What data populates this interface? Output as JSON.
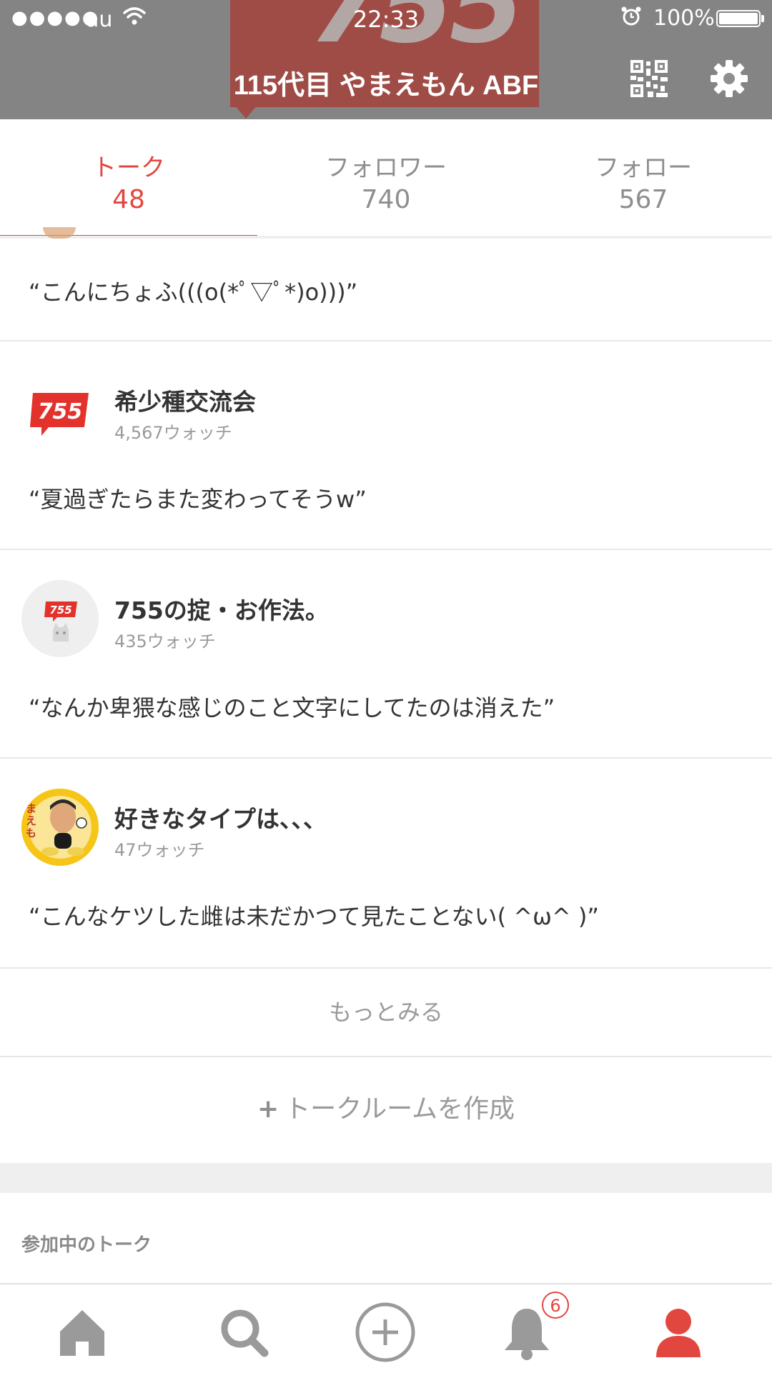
{
  "status_bar": {
    "signal": "●●●●●",
    "carrier": "au",
    "time": "22:33",
    "battery": "100%"
  },
  "header": {
    "logo_text": "755",
    "title": "115代目 やまえもん ABF",
    "qr_icon": "qr-code-icon",
    "settings_icon": "gear-icon"
  },
  "tabs": [
    {
      "label": "トーク",
      "count": "48",
      "active": true
    },
    {
      "label": "フォロワー",
      "count": "740",
      "active": false
    },
    {
      "label": "フォロー",
      "count": "567",
      "active": false
    }
  ],
  "feed": [
    {
      "quote": "“こんにちょふ(((o(*ﾟ▽ﾟ*)o)))”"
    },
    {
      "name": "希少種交流会",
      "watch": "4,567ウォッチ",
      "logo": "755",
      "quote": "“夏過ぎたらまた変わってそうw”"
    },
    {
      "name": "755の掟・お作法。",
      "watch": "435ウォッチ",
      "logo": "755",
      "quote": "“なんか卑猥な感じのこと文字にしてたのは消えた”"
    },
    {
      "name": "好きなタイプは、、、",
      "watch": "47ウォッチ",
      "avatar_text": "まえも",
      "quote": "“こんなケツした雌は未だかつて見たことない( ^ω^ )”"
    }
  ],
  "more_label": "もっとみる",
  "create_room": {
    "plus": "+",
    "label": "トークルームを作成"
  },
  "section_title": "参加中のトーク",
  "bottom_nav": {
    "items": [
      "home-icon",
      "search-icon",
      "post-icon",
      "notification-icon",
      "profile-icon"
    ],
    "notification_badge": "6"
  },
  "colors": {
    "accent": "#e2473f",
    "header_bg": "#8a8a8a",
    "logo_red": "#b6352b"
  }
}
